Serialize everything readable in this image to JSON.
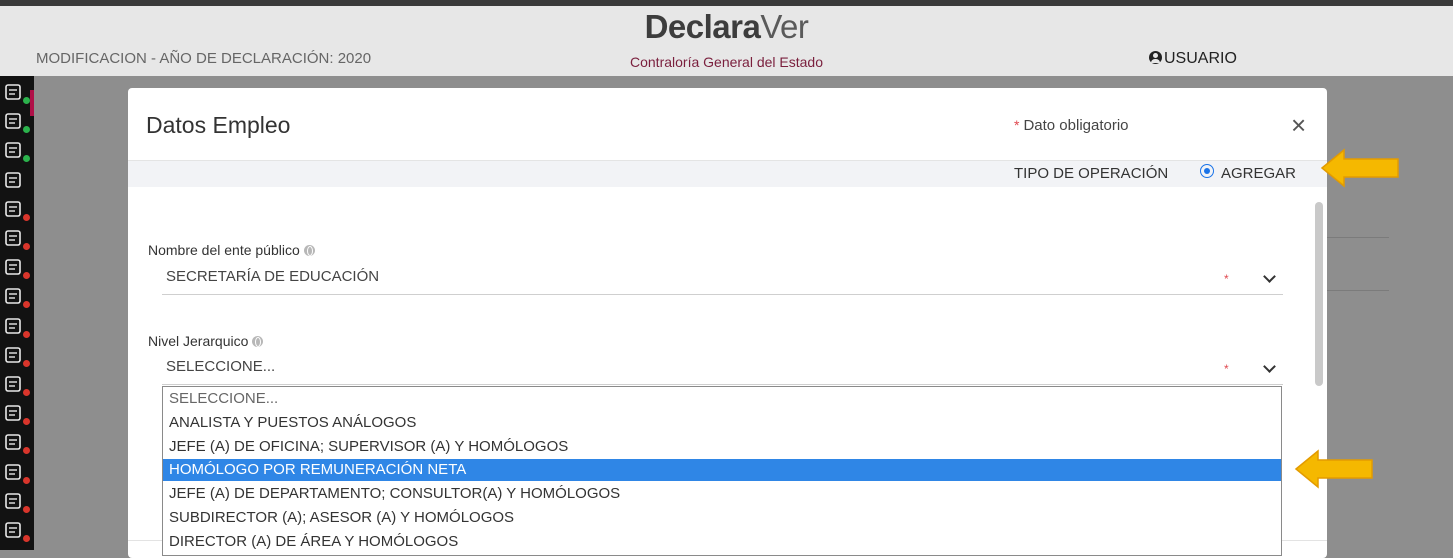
{
  "header": {
    "declaration_label": "MODIFICACION - AÑO DE DECLARACIÓN: 2020",
    "brand_part1": "Declara",
    "brand_part2": "Ver",
    "subtitle": "Contraloría General del Estado",
    "user_label": "USUARIO"
  },
  "sidebar": {
    "items": [
      {
        "icon": "id-card-icon",
        "status": "complete"
      },
      {
        "icon": "home-info-icon",
        "status": "complete"
      },
      {
        "icon": "document-icon",
        "status": "complete"
      },
      {
        "icon": "building-icon",
        "status": "current"
      },
      {
        "icon": "people-icon",
        "status": "pending"
      },
      {
        "icon": "family-icon",
        "status": "pending"
      },
      {
        "icon": "form-icon",
        "status": "pending"
      },
      {
        "icon": "money-icon",
        "status": "pending"
      },
      {
        "icon": "house-icon",
        "status": "pending"
      },
      {
        "icon": "car-icon",
        "status": "pending"
      },
      {
        "icon": "chart-icon",
        "status": "pending"
      },
      {
        "icon": "hand-shield-icon",
        "status": "pending"
      },
      {
        "icon": "vehicle-icon",
        "status": "pending"
      },
      {
        "icon": "home-gear-icon",
        "status": "pending"
      },
      {
        "icon": "pie-icon",
        "status": "pending"
      },
      {
        "icon": "person-icon",
        "status": "pending"
      }
    ],
    "colors": {
      "complete": "#2bb24c",
      "pending": "#d9352b"
    }
  },
  "modal": {
    "title": "Datos Empleo",
    "required_note": "Dato obligatorio",
    "required_star": "*",
    "close": "×",
    "operation_label": "TIPO DE OPERACIÓN",
    "operation_option": "AGREGAR",
    "fields": {
      "ente": {
        "label": "Nombre del ente público",
        "value": "SECRETARÍA DE EDUCACIÓN"
      },
      "nivel": {
        "label": "Nivel Jerarquico",
        "value": "SELECCIONE..."
      }
    }
  },
  "dropdown": {
    "options": [
      "SELECCIONE...",
      "ANALISTA Y PUESTOS ANÁLOGOS",
      "JEFE (A) DE OFICINA; SUPERVISOR (A) Y HOMÓLOGOS",
      "HOMÓLOGO POR REMUNERACIÓN NETA",
      "JEFE (A) DE DEPARTAMENTO; CONSULTOR(A) Y HOMÓLOGOS",
      "SUBDIRECTOR (A); ASESOR (A) Y HOMÓLOGOS",
      "DIRECTOR (A) DE ÁREA Y HOMÓLOGOS"
    ],
    "highlighted": "HOMÓLOGO POR REMUNERACIÓN NETA"
  },
  "colors": {
    "accent": "#2f86e6",
    "brand": "#7a1f3d",
    "arrow": "#f5b800"
  }
}
